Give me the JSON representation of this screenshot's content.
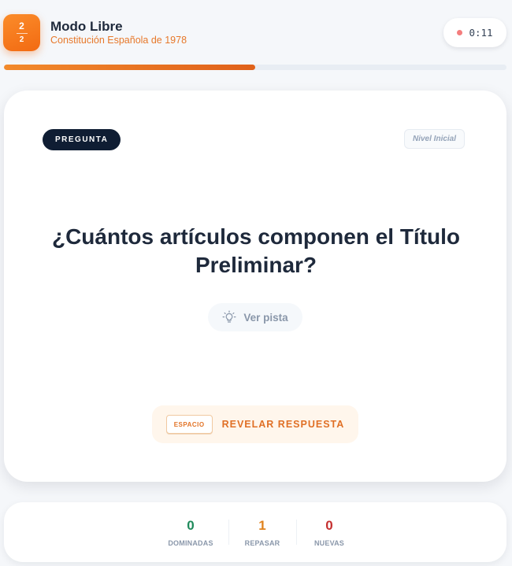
{
  "header": {
    "counter": {
      "current": "2",
      "total": "2"
    },
    "title": "Modo Libre",
    "subtitle": "Constitución Española de 1978",
    "timer": "0:11",
    "progress_percent": 50,
    "colors": {
      "accent": "#f26a12",
      "timer_dot": "#f47d7d"
    }
  },
  "card": {
    "tag": "PREGUNTA",
    "level": "Nivel Inicial",
    "question": "¿Cuántos artículos componen el Título Preliminar?",
    "hint": {
      "icon": "lightbulb-icon",
      "label": "Ver pista"
    },
    "reveal": {
      "key": "ESPACIO",
      "label": "REVELAR RESPUESTA"
    }
  },
  "stats": [
    {
      "value": "0",
      "label": "DOMINADAS",
      "color": "#1f8a5b"
    },
    {
      "value": "1",
      "label": "REPASAR",
      "color": "#e0821e"
    },
    {
      "value": "0",
      "label": "NUEVAS",
      "color": "#c53030"
    }
  ]
}
